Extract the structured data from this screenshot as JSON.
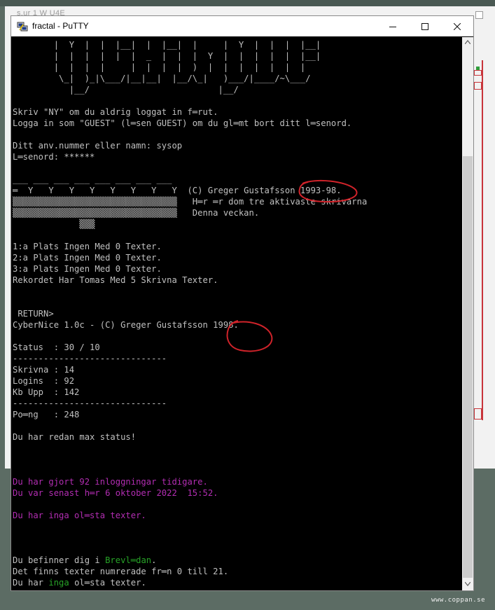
{
  "background": {
    "title_fragment": "s.ur   1   W  U4E"
  },
  "window": {
    "title": "fractal - PuTTY",
    "icon": "putty-icon",
    "min_icon": "minimize-icon",
    "max_icon": "maximize-icon",
    "close_icon": "close-icon"
  },
  "terminal": {
    "lines": [
      {
        "id": "logo1",
        "text": "        |  Y  |  |  |__|  |  |__|  |     |  Y  |  |  |  |__|"
      },
      {
        "id": "logo2",
        "text": "        |  |  |  |  |  |  _  |  |  |  Y  |  |  |  |  |  |__|"
      },
      {
        "id": "logo3",
        "text": "        |  |  |  |     |  |  |  |  )  |  |  |  |  |  |  |"
      },
      {
        "id": "logo4",
        "text": "         \\_|  )_|\\___/|__|__|  |__/\\_|   )___/|____/~\\___/"
      },
      {
        "id": "logo5",
        "text": "           |__/                         |__/"
      },
      {
        "id": "blank1",
        "text": ""
      },
      {
        "id": "l1",
        "text": "Skriv \"NY\" om du aldrig loggat in f═rut."
      },
      {
        "id": "l2",
        "text": "Logga in som \"GUEST\" (l═sen GUEST) om du gl═mt bort ditt l═senord."
      },
      {
        "id": "blank2",
        "text": ""
      },
      {
        "id": "l3",
        "text": "Ditt anv.nummer eller namn: sysop"
      },
      {
        "id": "l4",
        "text": "L═senord: ******"
      },
      {
        "id": "blank3",
        "text": ""
      },
      {
        "id": "art0",
        "text": "___ ___ ___ ___ ___ ___ ___ ___"
      },
      {
        "id": "art1",
        "text": "═  Y   Y   Y   Y   Y   Y   Y   Y  (C) Greger Gustafsson 1993-98."
      },
      {
        "id": "art2",
        "text": "▒▒▒▒▒▒▒▒▒▒▒▒▒▒▒▒▒▒▒▒▒▒▒▒▒▒▒▒▒▒▒▒   H═r ═r dom tre aktivaste skrivarna"
      },
      {
        "id": "art3",
        "text": "▒▒▒▒▒▒▒▒▒▒▒▒▒▒▒▒▒▒▒▒▒▒▒▒▒▒▒▒▒▒▒▒   Denna veckan."
      },
      {
        "id": "art4",
        "text": "             ▒▒▒"
      },
      {
        "id": "blank4",
        "text": ""
      },
      {
        "id": "p1",
        "text": "1:a Plats Ingen Med 0 Texter."
      },
      {
        "id": "p2",
        "text": "2:a Plats Ingen Med 0 Texter."
      },
      {
        "id": "p3",
        "text": "3:a Plats Ingen Med 0 Texter."
      },
      {
        "id": "p4",
        "text": "Rekordet Har Tomas Med 5 Skrivna Texter."
      },
      {
        "id": "blank5",
        "text": ""
      },
      {
        "id": "blank6",
        "text": ""
      },
      {
        "id": "ret",
        "text": " RETURN>"
      },
      {
        "id": "cn",
        "text": "CyberNice 1.0c - (C) Greger Gustafsson 1998."
      },
      {
        "id": "blank7",
        "text": ""
      },
      {
        "id": "st",
        "text": "Status  : 30 / 10"
      },
      {
        "id": "sep1",
        "text": "------------------------------"
      },
      {
        "id": "sk",
        "text": "Skrivna : 14"
      },
      {
        "id": "lg",
        "text": "Logins  : 92"
      },
      {
        "id": "kb",
        "text": "Kb Upp  : 142"
      },
      {
        "id": "sep2",
        "text": "------------------------------"
      },
      {
        "id": "po",
        "text": "Po═ng   : 248"
      },
      {
        "id": "blank8",
        "text": ""
      },
      {
        "id": "mx",
        "text": "Du har redan max status!"
      },
      {
        "id": "blank9",
        "text": ""
      },
      {
        "id": "blank10",
        "text": ""
      },
      {
        "id": "blank11",
        "text": ""
      },
      {
        "id": "m1",
        "text": "Du har gjort 92 inloggningar tidigare.",
        "color": "magenta"
      },
      {
        "id": "m2",
        "text": "Du var senast h═r 6 oktober 2022  15:52.",
        "color": "magenta"
      },
      {
        "id": "blank12",
        "text": ""
      },
      {
        "id": "m3",
        "text": "Du har inga ol═sta texter.",
        "color": "magenta"
      },
      {
        "id": "blank13",
        "text": ""
      },
      {
        "id": "blank14",
        "text": ""
      },
      {
        "id": "blank15",
        "text": ""
      },
      {
        "id": "b1",
        "segments": [
          {
            "text": "Du befinner dig i "
          },
          {
            "text": "Brevl═dan",
            "color": "green"
          },
          {
            "text": "."
          }
        ]
      },
      {
        "id": "b2",
        "text": "Det finns texter numrerade fr═n 0 till 21."
      },
      {
        "id": "b3",
        "segments": [
          {
            "text": "Du har "
          },
          {
            "text": "inga",
            "color": "green"
          },
          {
            "text": " ol═sta texter."
          }
        ]
      }
    ]
  },
  "scrollbar": {
    "up_icon": "scroll-up-icon",
    "down_icon": "scroll-down-icon"
  },
  "annotations": {
    "color": "#d0232a",
    "circled_texts": [
      "1993-98.",
      "1998."
    ]
  },
  "colors": {
    "terminal_fg": "#c0c0c0",
    "magenta": "#b22db2",
    "green": "#27a327"
  },
  "watermark": "www.coppan.se"
}
